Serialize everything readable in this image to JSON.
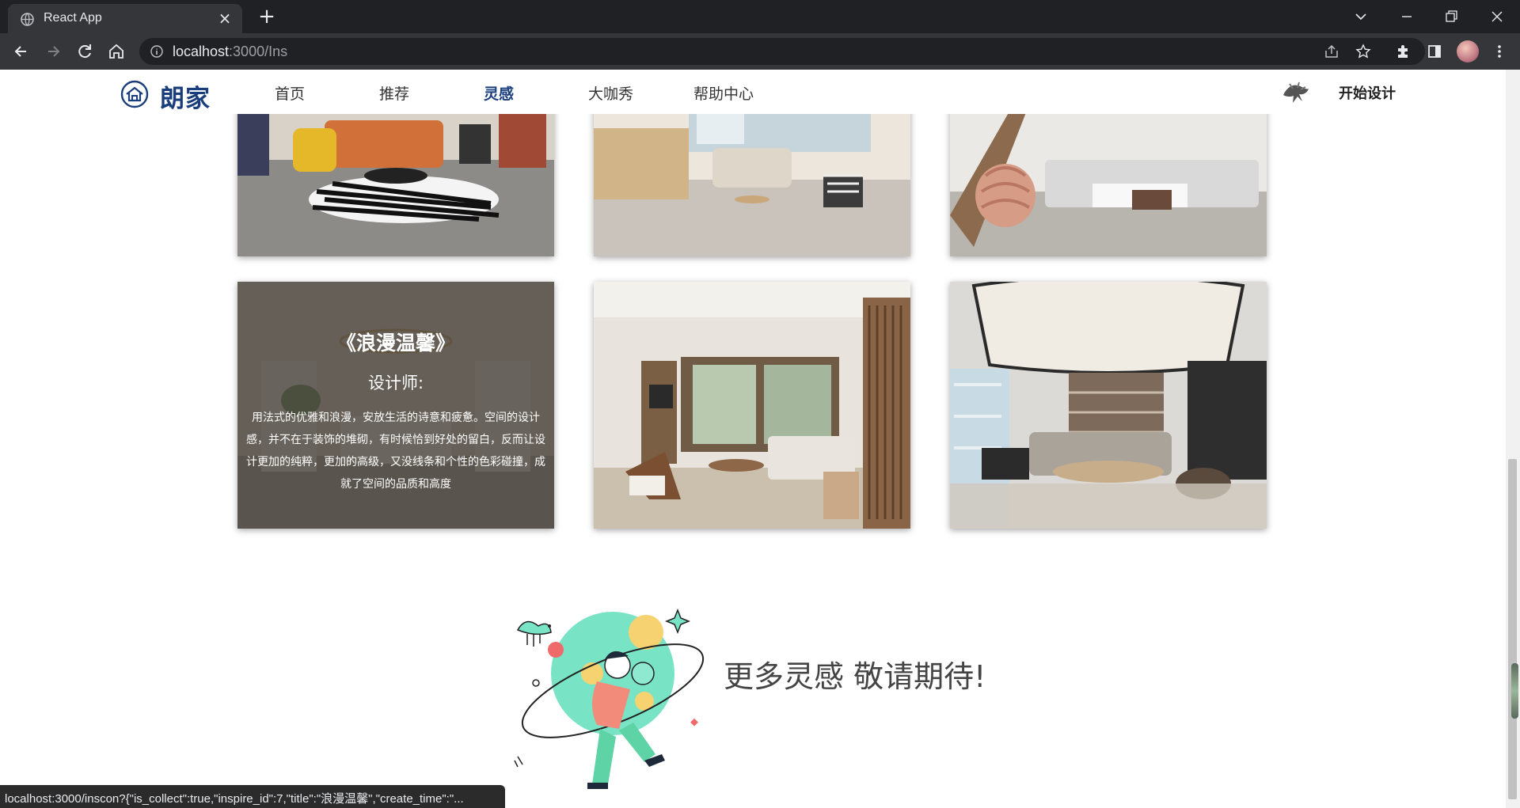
{
  "browser": {
    "tab_title": "React App",
    "url_host": "localhost",
    "url_path": ":3000/Ins",
    "status_url": "localhost:3000/inscon?{\"is_collect\":true,\"inspire_id\":7,\"title\":\"浪漫温馨\",\"create_time\":\"..."
  },
  "site": {
    "logo": "朗家",
    "nav": [
      {
        "label": "首页",
        "active": false
      },
      {
        "label": "推荐",
        "active": false
      },
      {
        "label": "灵感",
        "active": true
      },
      {
        "label": "大咖秀",
        "active": false
      },
      {
        "label": "帮助中心",
        "active": false
      }
    ],
    "cta": "开始设计"
  },
  "gallery": {
    "hover_card": {
      "title": "《浪漫温馨》",
      "designer": "设计师:",
      "description": "用法式的优雅和浪漫，安放生活的诗意和疲惫。空间的设计感，并不在于装饰的堆砌，有时候恰到好处的留白，反而让设计更加的纯粹，更加的高级，又没线条和个性的色彩碰撞，成就了空间的品质和高度"
    }
  },
  "footer": {
    "more_text": "更多灵感 敬请期待!"
  },
  "colors": {
    "brand": "#1a3d7c",
    "chrome_dark": "#202124",
    "chrome_tab": "#35363a"
  }
}
